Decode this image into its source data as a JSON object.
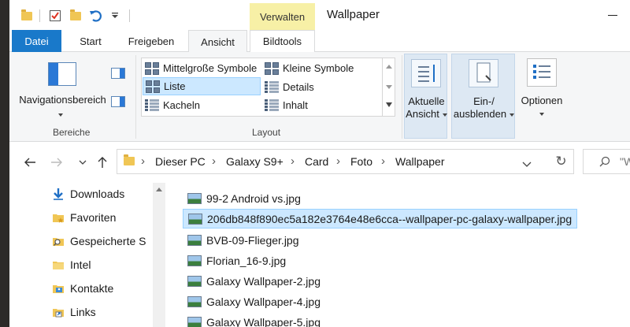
{
  "titlebar": {
    "context_tab": "Verwalten",
    "window_title": "Wallpaper"
  },
  "tabs": {
    "datei": "Datei",
    "start": "Start",
    "freigeben": "Freigeben",
    "ansicht": "Ansicht",
    "bildtools": "Bildtools"
  },
  "ribbon": {
    "bereiche": {
      "navigationsbereich": "Navigationsbereich",
      "group_label": "Bereiche"
    },
    "layout": {
      "items": [
        "Mittelgroße Symbole",
        "Kleine Symbole",
        "Liste",
        "Details",
        "Kacheln",
        "Inhalt"
      ],
      "selected": "Liste",
      "group_label": "Layout"
    },
    "aktuelle_ansicht": {
      "line1": "Aktuelle",
      "line2": "Ansicht"
    },
    "ein_ausblenden": {
      "line1": "Ein-/",
      "line2": "ausblenden"
    },
    "optionen": "Optionen"
  },
  "address": {
    "crumbs": [
      "Dieser PC",
      "Galaxy S9+",
      "Card",
      "Foto",
      "Wallpaper"
    ],
    "search_placeholder": "\"W"
  },
  "navpane": {
    "items": [
      {
        "label": "Downloads",
        "icon": "download-arrow-icon"
      },
      {
        "label": "Favoriten",
        "icon": "folder-star-icon"
      },
      {
        "label": "Gespeicherte S",
        "icon": "folder-search-icon"
      },
      {
        "label": "Intel",
        "icon": "folder-icon"
      },
      {
        "label": "Kontakte",
        "icon": "contacts-icon"
      },
      {
        "label": "Links",
        "icon": "folder-link-icon"
      }
    ]
  },
  "files": {
    "items": [
      "99-2 Android vs.jpg",
      "206db848f890ec5a182e3764e48e6cca--wallpaper-pc-galaxy-wallpaper.jpg",
      "BVB-09-Flieger.jpg",
      "Florian_16-9.jpg",
      "Galaxy Wallpaper-2.jpg",
      "Galaxy Wallpaper-4.jpg",
      "Galaxy Wallpaper-5.jpg"
    ],
    "selected_index": 1
  },
  "colors": {
    "accent": "#1979ca",
    "selection": "#cce8ff",
    "context_tab": "#f7f0a6"
  }
}
